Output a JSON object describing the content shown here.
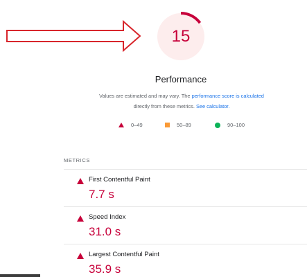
{
  "score": {
    "value": "15",
    "fraction": 0.15
  },
  "category_title": "Performance",
  "description": {
    "line1_text": "Values are estimated and may vary. The ",
    "line1_link": "performance score is calculated",
    "line2_text": "directly from these metrics. ",
    "line2_link": "See calculator."
  },
  "legend": [
    {
      "icon": "triangle-icon",
      "label": "0–49",
      "color": "#c7003a"
    },
    {
      "icon": "square-icon",
      "label": "50–89",
      "color": "#fa9a36"
    },
    {
      "icon": "circle-icon",
      "label": "90–100",
      "color": "#0cb358"
    }
  ],
  "metrics_header": "METRICS",
  "metrics": [
    {
      "label": "First Contentful Paint",
      "value": "7.7 s"
    },
    {
      "label": "Speed Index",
      "value": "31.0 s"
    },
    {
      "label": "Largest Contentful Paint",
      "value": "35.9 s"
    }
  ],
  "colors": {
    "fail": "#c7003a",
    "fail_bg": "#fdeded",
    "average": "#fa9a36",
    "pass": "#0cb358",
    "link": "#1a73e8",
    "annotation_arrow": "#d8262c"
  }
}
